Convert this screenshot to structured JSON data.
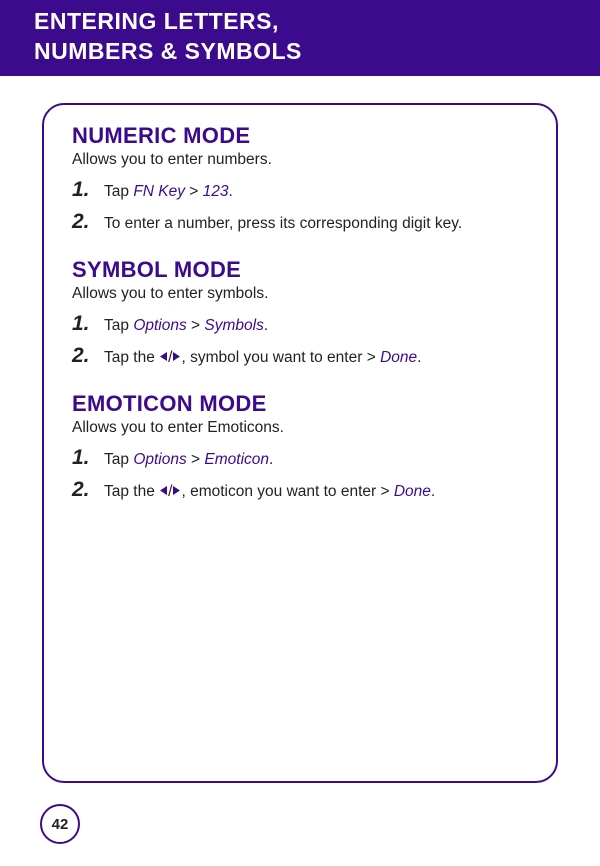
{
  "header": {
    "title_line1": "ENTERING LETTERS,",
    "title_line2": "NUMBERS & SYMBOLS"
  },
  "page_number": "42",
  "sections": {
    "numeric": {
      "title": "NUMERIC MODE",
      "desc": "Allows you to enter numbers.",
      "s1_num": "1.",
      "s1_a": "Tap ",
      "s1_k1": "FN Key",
      "s1_b": " > ",
      "s1_k2": "123",
      "s1_c": ".",
      "s2_num": "2.",
      "s2_a": "To enter a number, press its corresponding digit key."
    },
    "symbol": {
      "title": "SYMBOL MODE",
      "desc": "Allows you to enter symbols.",
      "s1_num": "1.",
      "s1_a": "Tap ",
      "s1_k1": "Options",
      "s1_b": " > ",
      "s1_k2": "Symbols",
      "s1_c": ".",
      "s2_num": "2.",
      "s2_a": "Tap the ",
      "s2_b": ", symbol you want to enter > ",
      "s2_k1": "Done",
      "s2_c": "."
    },
    "emoticon": {
      "title": "EMOTICON MODE",
      "desc": "Allows you to enter Emoticons.",
      "s1_num": "1.",
      "s1_a": "Tap ",
      "s1_k1": "Options",
      "s1_b": " > ",
      "s1_k2": "Emoticon",
      "s1_c": ".",
      "s2_num": "2.",
      "s2_a": "Tap the ",
      "s2_b": ", emoticon you want to enter > ",
      "s2_k1": "Done",
      "s2_c": "."
    }
  }
}
